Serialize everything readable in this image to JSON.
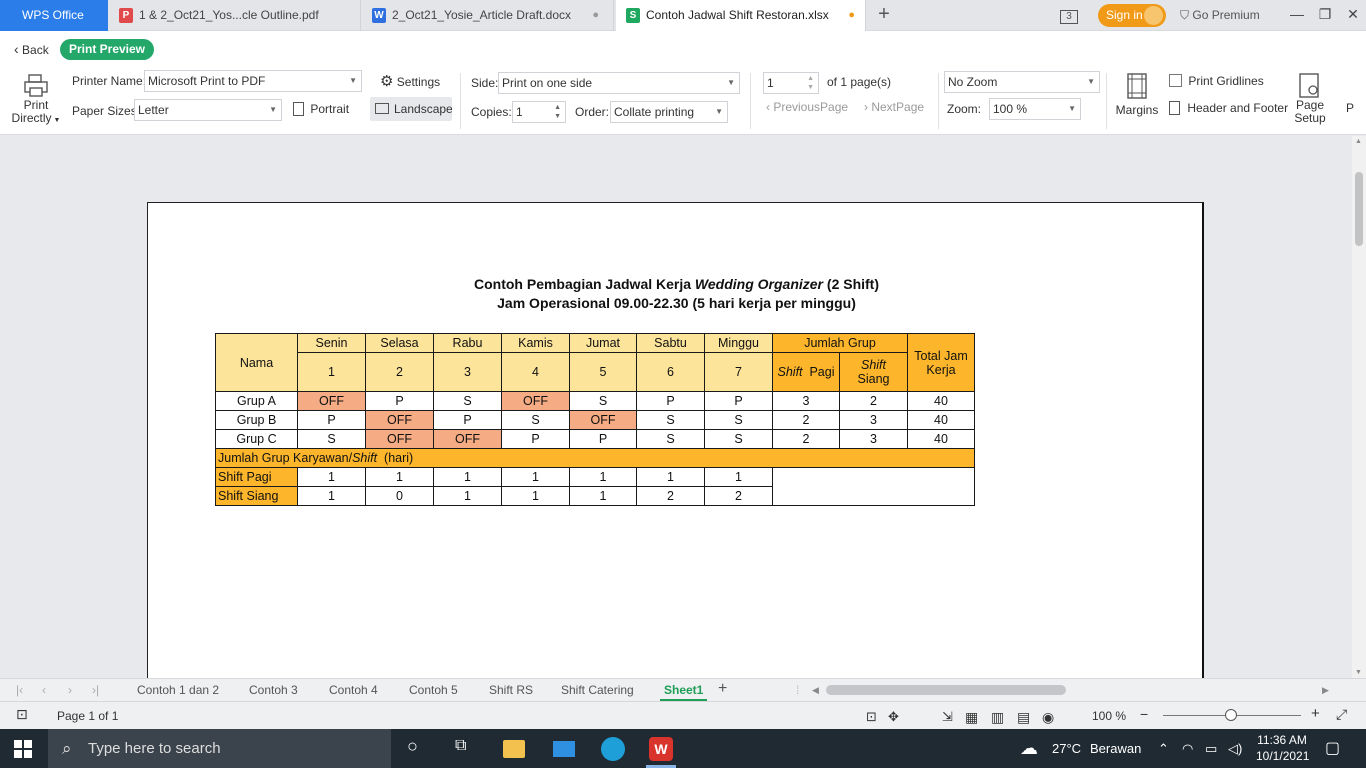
{
  "app": {
    "name": "WPS Office"
  },
  "tabs": [
    {
      "label": "1 & 2_Oct21_Yos...cle Outline.pdf",
      "type": "pdf",
      "icon_color": "#e04a4a"
    },
    {
      "label": "2_Oct21_Yosie_Article Draft.docx",
      "type": "docx",
      "icon_color": "#2f6fe0"
    },
    {
      "label": "Contoh Jadwal Shift Restoran.xlsx",
      "type": "xlsx",
      "icon_color": "#1fa85f",
      "active": true
    }
  ],
  "titlebar": {
    "badge": "3",
    "sign_in": "Sign in",
    "go_premium": "Go Premium"
  },
  "nav": {
    "back": "Back",
    "print_preview": "Print Preview"
  },
  "toolbar": {
    "print_directly": [
      "Print",
      "Directly"
    ],
    "printer_name_label": "Printer Name:",
    "printer_name": "Microsoft Print to PDF",
    "settings": "Settings",
    "paper_sizes_label": "Paper Sizes:",
    "paper_size": "Letter",
    "portrait": "Portrait",
    "landscape": "Landscape",
    "side_label": "Side:",
    "side_value": "Print on one side",
    "copies_label": "Copies:",
    "copies_value": "1",
    "order_label": "Order:",
    "order_value": "Collate printing",
    "page_input": "1",
    "of_pages": "of 1 page(s)",
    "previous_page": "PreviousPage",
    "next_page": "NextPage",
    "zoom_mode": "No Zoom",
    "zoom_label": "Zoom:",
    "zoom_value": "100 %",
    "margins": "Margins",
    "print_gridlines": "Print Gridlines",
    "header_footer": "Header and Footer",
    "page_setup": [
      "Page",
      "Setup"
    ],
    "more": "P"
  },
  "document": {
    "title_prefix": "Contoh Pembagian Jadwal Kerja ",
    "title_italic": "Wedding Organizer",
    "title_suffix": " (2 Shift)",
    "subtitle": "Jam Operasional 09.00-22.30 (5 hari kerja per minggu)",
    "table": {
      "nama": "Nama",
      "days": [
        "Senin",
        "Selasa",
        "Rabu",
        "Kamis",
        "Jumat",
        "Sabtu",
        "Minggu"
      ],
      "day_nums": [
        "1",
        "2",
        "3",
        "4",
        "5",
        "6",
        "7"
      ],
      "jumlah_grup": "Jumlah Grup",
      "shift_word": "Shift",
      "pagi": "Pagi",
      "siang": "Siang",
      "total_jam": [
        "Total Jam",
        "Kerja"
      ],
      "groups": [
        {
          "name": "Grup A",
          "days": [
            "OFF",
            "P",
            "S",
            "OFF",
            "S",
            "P",
            "P"
          ],
          "pagi": "3",
          "siang": "2",
          "total": "40"
        },
        {
          "name": "Grup B",
          "days": [
            "P",
            "OFF",
            "P",
            "S",
            "OFF",
            "S",
            "S"
          ],
          "pagi": "2",
          "siang": "3",
          "total": "40"
        },
        {
          "name": "Grup C",
          "days": [
            "S",
            "OFF",
            "OFF",
            "P",
            "P",
            "S",
            "S"
          ],
          "pagi": "2",
          "siang": "3",
          "total": "40"
        }
      ],
      "band_prefix": "Jumlah Grup Karyawan/",
      "band_italic": "Shift",
      "band_suffix": "  (hari)",
      "shift_pagi_label": "Shift Pagi",
      "shift_siang_label": "Shift Siang",
      "shift_pagi_counts": [
        "1",
        "1",
        "1",
        "1",
        "1",
        "1",
        "1"
      ],
      "shift_siang_counts": [
        "1",
        "0",
        "1",
        "1",
        "1",
        "2",
        "2"
      ]
    }
  },
  "sheets": [
    "Contoh 1 dan 2",
    "Contoh 3",
    "Contoh 4",
    "Contoh 5",
    "Shift RS",
    "Shift Catering",
    "Sheet1"
  ],
  "active_sheet": "Sheet1",
  "status": {
    "page": "Page 1 of 1",
    "zoom": "100 %"
  },
  "taskbar": {
    "search_placeholder": "Type here to search",
    "temperature": "27°C",
    "weather": "Berawan",
    "time": "11:36 AM",
    "date": "10/1/2021"
  }
}
